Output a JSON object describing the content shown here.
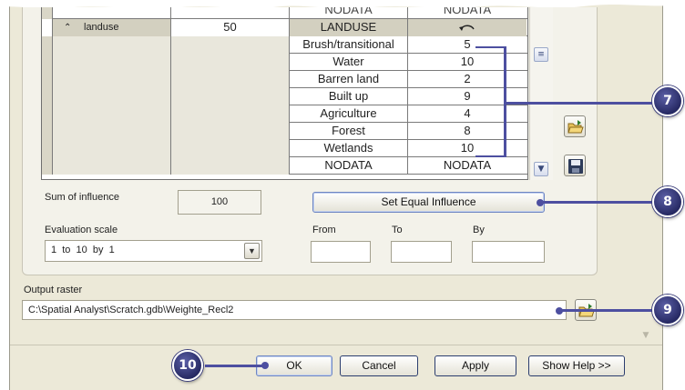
{
  "table": {
    "top_row": {
      "old": "NODATA",
      "new": "NODATA"
    },
    "header": {
      "layer": "landuse",
      "influence": "50",
      "field": "LANDUSE"
    },
    "rows": [
      {
        "old": "Brush/transitional",
        "new": "5"
      },
      {
        "old": "Water",
        "new": "10"
      },
      {
        "old": "Barren land",
        "new": "2"
      },
      {
        "old": "Built up",
        "new": "9"
      },
      {
        "old": "Agriculture",
        "new": "4"
      },
      {
        "old": "Forest",
        "new": "8"
      },
      {
        "old": "Wetlands",
        "new": "10"
      },
      {
        "old": "NODATA",
        "new": "NODATA"
      }
    ]
  },
  "influence": {
    "sum_label": "Sum of influence",
    "sum_value": "100",
    "equal_button": "Set Equal Influence"
  },
  "scale": {
    "label": "Evaluation scale",
    "value": "1  to  10  by  1",
    "from_label": "From",
    "to_label": "To",
    "by_label": "By",
    "from_value": "",
    "to_value": "",
    "by_value": ""
  },
  "output": {
    "label": "Output raster",
    "path": "C:\\Spatial Analyst\\Scratch.gdb\\Weighte_Recl2"
  },
  "buttons": {
    "ok": "OK",
    "cancel": "Cancel",
    "apply": "Apply",
    "help": "Show Help >>"
  },
  "callouts": {
    "c7": "7",
    "c8": "8",
    "c9": "9",
    "c10": "10"
  },
  "icons": {
    "undo": "undo-arrow-icon",
    "open": "open-folder-icon",
    "save": "save-disk-icon",
    "browse": "browse-folder-icon",
    "sort": "sort-up-icon"
  },
  "colors": {
    "callout": "#2e3170",
    "callout_line": "#4d4fa0",
    "dialog_bg": "#ece9d8"
  }
}
